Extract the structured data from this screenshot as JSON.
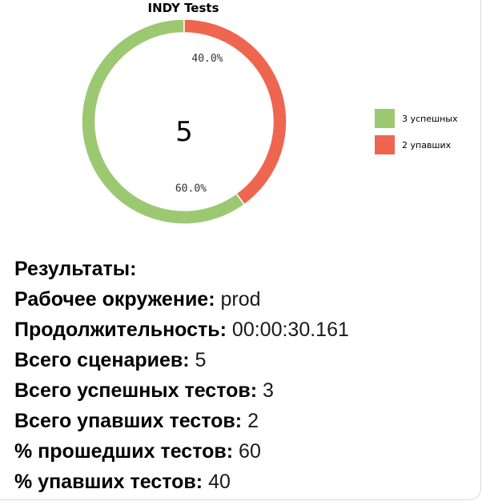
{
  "chart_data": {
    "type": "pie",
    "title": "INDY Tests",
    "center_label": "5",
    "slices": [
      {
        "name": "3 успешных",
        "value": 60.0,
        "label": "60.0%",
        "color": "#9dc872"
      },
      {
        "name": "2 упавших",
        "value": 40.0,
        "label": "40.0%",
        "color": "#ee6650"
      }
    ],
    "legend_placement": "right"
  },
  "results": {
    "heading": "Результаты:",
    "environment_label": "Рабочее окружение:",
    "environment_value": "prod",
    "duration_label": "Продолжительность:",
    "duration_value": "00:00:30.161",
    "scenarios_label": "Всего сценариев:",
    "scenarios_value": "5",
    "passed_label": "Всего успешных тестов:",
    "passed_value": "3",
    "failed_label": "Всего упавших тестов:",
    "failed_value": "2",
    "pct_passed_label": "% прошедших тестов:",
    "pct_passed_value": "60",
    "pct_failed_label": "% упавших тестов:",
    "pct_failed_value": "40"
  }
}
